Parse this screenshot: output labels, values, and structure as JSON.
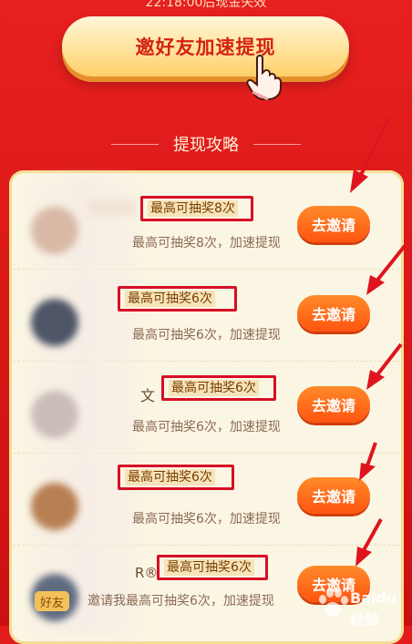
{
  "header": {
    "expire_text": "22:18:00后现金失效",
    "invite_button_label": "邀好友加速提现"
  },
  "guide": {
    "title": "提现攻略"
  },
  "rows": [
    {
      "badge": "最高可抽奖8次",
      "desc": "最高可抽奖8次，加速提现",
      "button": "去邀请"
    },
    {
      "badge": "最高可抽奖6次",
      "desc": "最高可抽奖6次，加速提现",
      "button": "去邀请"
    },
    {
      "badge": "最高可抽奖6次",
      "desc": "最高可抽奖6次，加速提现",
      "button": "去邀请"
    },
    {
      "badge": "最高可抽奖6次",
      "desc": "最高可抽奖6次，加速提现",
      "button": "去邀请"
    },
    {
      "badge": "最高可抽奖6次",
      "desc": "邀请我最高可抽奖6次，加速提现",
      "button": "去邀请"
    }
  ],
  "row3_fragment": "文 ·",
  "row5_fragment": "R®",
  "friend_tag": "好友",
  "watermark": "Baidu 经验",
  "colors": {
    "background_red": "#e21c1c",
    "highlight_box": "#d70f25",
    "go_button": "#ff5510",
    "panel": "#fbf6e3"
  }
}
